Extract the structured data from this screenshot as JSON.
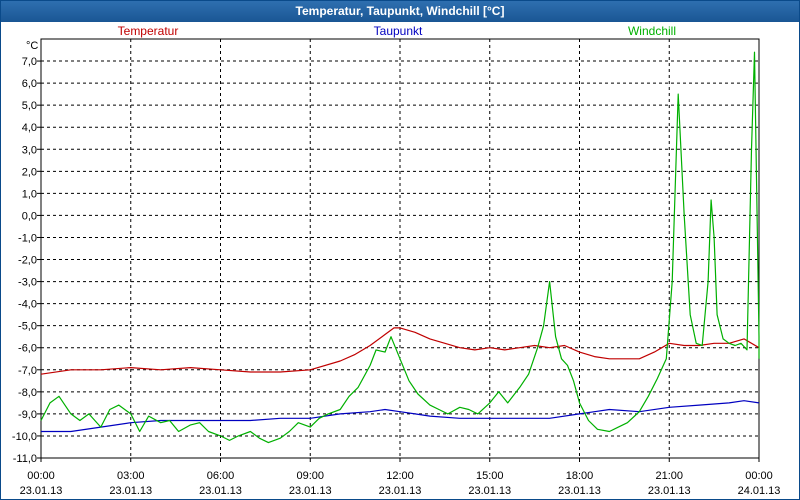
{
  "window": {
    "title": "Temperatur, Taupunkt, Windchill [°C]"
  },
  "chart_data": {
    "type": "line",
    "title": "Temperatur, Taupunkt, Windchill [°C]",
    "ylabel": "°C",
    "xlabel": "",
    "ylim": [
      -11.0,
      8.0
    ],
    "xlim": [
      "2013-01-23 00:00",
      "2013-01-24 00:00"
    ],
    "grid": true,
    "legend_position": "top",
    "y_ticks": [
      7.0,
      6.0,
      5.0,
      4.0,
      3.0,
      2.0,
      1.0,
      0.0,
      -1.0,
      -2.0,
      -3.0,
      -4.0,
      -5.0,
      -6.0,
      -7.0,
      -8.0,
      -9.0,
      -10.0,
      -11.0
    ],
    "y_tick_labels": [
      "7,0",
      "6,0",
      "5,0",
      "4,0",
      "3,0",
      "2,0",
      "1,0",
      "0,0",
      "-1,0",
      "-2,0",
      "-3,0",
      "-4,0",
      "-5,0",
      "-6,0",
      "-7,0",
      "-8,0",
      "-9,0",
      "-10,0",
      "-11,0"
    ],
    "x_ticks": [
      {
        "time": "00:00",
        "date": "23.01.13",
        "hour": 0
      },
      {
        "time": "03:00",
        "date": "23.01.13",
        "hour": 3
      },
      {
        "time": "06:00",
        "date": "23.01.13",
        "hour": 6
      },
      {
        "time": "09:00",
        "date": "23.01.13",
        "hour": 9
      },
      {
        "time": "12:00",
        "date": "23.01.13",
        "hour": 12
      },
      {
        "time": "15:00",
        "date": "23.01.13",
        "hour": 15
      },
      {
        "time": "18:00",
        "date": "23.01.13",
        "hour": 18
      },
      {
        "time": "21:00",
        "date": "23.01.13",
        "hour": 21
      },
      {
        "time": "00:00",
        "date": "24.01.13",
        "hour": 24
      }
    ],
    "series": [
      {
        "name": "Temperatur",
        "color": "#c00000",
        "points": [
          [
            0,
            -7.2
          ],
          [
            1,
            -7.0
          ],
          [
            2,
            -7.0
          ],
          [
            3,
            -6.9
          ],
          [
            4,
            -7.0
          ],
          [
            5,
            -6.9
          ],
          [
            6,
            -7.0
          ],
          [
            7,
            -7.1
          ],
          [
            8,
            -7.1
          ],
          [
            9,
            -7.0
          ],
          [
            10,
            -6.6
          ],
          [
            10.5,
            -6.3
          ],
          [
            11,
            -5.9
          ],
          [
            11.5,
            -5.4
          ],
          [
            11.8,
            -5.1
          ],
          [
            12,
            -5.1
          ],
          [
            12.5,
            -5.3
          ],
          [
            13,
            -5.6
          ],
          [
            13.5,
            -5.8
          ],
          [
            14,
            -6.0
          ],
          [
            14.5,
            -6.1
          ],
          [
            15,
            -6.0
          ],
          [
            15.5,
            -6.1
          ],
          [
            16,
            -6.0
          ],
          [
            16.5,
            -5.9
          ],
          [
            17,
            -6.0
          ],
          [
            17.5,
            -5.9
          ],
          [
            18,
            -6.2
          ],
          [
            18.5,
            -6.4
          ],
          [
            19,
            -6.5
          ],
          [
            19.5,
            -6.5
          ],
          [
            20,
            -6.5
          ],
          [
            20.5,
            -6.2
          ],
          [
            21,
            -5.8
          ],
          [
            21.5,
            -5.9
          ],
          [
            22,
            -5.9
          ],
          [
            22.5,
            -5.8
          ],
          [
            23,
            -5.8
          ],
          [
            23.5,
            -5.6
          ],
          [
            24,
            -6.0
          ]
        ]
      },
      {
        "name": "Taupunkt",
        "color": "#0000c0",
        "points": [
          [
            0,
            -9.8
          ],
          [
            1,
            -9.8
          ],
          [
            2,
            -9.6
          ],
          [
            3,
            -9.4
          ],
          [
            4,
            -9.3
          ],
          [
            5,
            -9.3
          ],
          [
            6,
            -9.3
          ],
          [
            7,
            -9.3
          ],
          [
            8,
            -9.2
          ],
          [
            9,
            -9.2
          ],
          [
            10,
            -9.0
          ],
          [
            11,
            -8.9
          ],
          [
            11.5,
            -8.8
          ],
          [
            12,
            -8.9
          ],
          [
            12.5,
            -9.0
          ],
          [
            13,
            -9.1
          ],
          [
            14,
            -9.2
          ],
          [
            15,
            -9.2
          ],
          [
            16,
            -9.2
          ],
          [
            17,
            -9.2
          ],
          [
            18,
            -9.0
          ],
          [
            18.5,
            -8.9
          ],
          [
            19,
            -8.8
          ],
          [
            20,
            -8.9
          ],
          [
            21,
            -8.7
          ],
          [
            22,
            -8.6
          ],
          [
            23,
            -8.5
          ],
          [
            23.5,
            -8.4
          ],
          [
            24,
            -8.5
          ]
        ]
      },
      {
        "name": "Windchill",
        "color": "#00b000",
        "points": [
          [
            0,
            -9.3
          ],
          [
            0.3,
            -8.5
          ],
          [
            0.6,
            -8.2
          ],
          [
            1,
            -9.0
          ],
          [
            1.3,
            -9.3
          ],
          [
            1.6,
            -9.0
          ],
          [
            2,
            -9.6
          ],
          [
            2.3,
            -8.8
          ],
          [
            2.6,
            -8.6
          ],
          [
            3,
            -9.0
          ],
          [
            3.3,
            -9.8
          ],
          [
            3.6,
            -9.1
          ],
          [
            4,
            -9.4
          ],
          [
            4.3,
            -9.3
          ],
          [
            4.6,
            -9.8
          ],
          [
            5,
            -9.5
          ],
          [
            5.3,
            -9.4
          ],
          [
            5.6,
            -9.8
          ],
          [
            6,
            -10.0
          ],
          [
            6.3,
            -10.2
          ],
          [
            6.6,
            -10.0
          ],
          [
            7,
            -9.8
          ],
          [
            7.3,
            -10.1
          ],
          [
            7.6,
            -10.3
          ],
          [
            8,
            -10.1
          ],
          [
            8.3,
            -9.8
          ],
          [
            8.6,
            -9.4
          ],
          [
            9,
            -9.6
          ],
          [
            9.3,
            -9.2
          ],
          [
            9.6,
            -9.0
          ],
          [
            10,
            -8.8
          ],
          [
            10.3,
            -8.2
          ],
          [
            10.6,
            -7.8
          ],
          [
            11,
            -6.8
          ],
          [
            11.2,
            -6.1
          ],
          [
            11.5,
            -6.2
          ],
          [
            11.7,
            -5.5
          ],
          [
            12,
            -6.5
          ],
          [
            12.3,
            -7.5
          ],
          [
            12.6,
            -8.1
          ],
          [
            13,
            -8.6
          ],
          [
            13.3,
            -8.8
          ],
          [
            13.6,
            -9.0
          ],
          [
            14,
            -8.7
          ],
          [
            14.3,
            -8.8
          ],
          [
            14.6,
            -9.0
          ],
          [
            15,
            -8.5
          ],
          [
            15.3,
            -8.0
          ],
          [
            15.6,
            -8.5
          ],
          [
            16,
            -7.8
          ],
          [
            16.3,
            -7.2
          ],
          [
            16.6,
            -6.0
          ],
          [
            16.8,
            -5.0
          ],
          [
            17,
            -3.0
          ],
          [
            17.2,
            -5.5
          ],
          [
            17.4,
            -6.5
          ],
          [
            17.6,
            -6.8
          ],
          [
            17.8,
            -7.5
          ],
          [
            18,
            -8.5
          ],
          [
            18.3,
            -9.3
          ],
          [
            18.6,
            -9.7
          ],
          [
            19,
            -9.8
          ],
          [
            19.3,
            -9.6
          ],
          [
            19.6,
            -9.4
          ],
          [
            20,
            -8.9
          ],
          [
            20.3,
            -8.2
          ],
          [
            20.6,
            -7.4
          ],
          [
            20.9,
            -6.5
          ],
          [
            21.1,
            -3.0
          ],
          [
            21.3,
            5.5
          ],
          [
            21.5,
            0.0
          ],
          [
            21.7,
            -4.5
          ],
          [
            21.9,
            -5.8
          ],
          [
            22.1,
            -5.9
          ],
          [
            22.3,
            -3.0
          ],
          [
            22.4,
            0.7
          ],
          [
            22.5,
            -1.0
          ],
          [
            22.6,
            -4.5
          ],
          [
            22.8,
            -5.6
          ],
          [
            23.0,
            -5.8
          ],
          [
            23.2,
            -5.9
          ],
          [
            23.4,
            -5.8
          ],
          [
            23.6,
            -6.1
          ],
          [
            23.75,
            3.0
          ],
          [
            23.85,
            7.4
          ],
          [
            24,
            -5.5
          ],
          [
            24.1,
            -6.0
          ],
          [
            24.3,
            -6.5
          ]
        ]
      }
    ]
  }
}
